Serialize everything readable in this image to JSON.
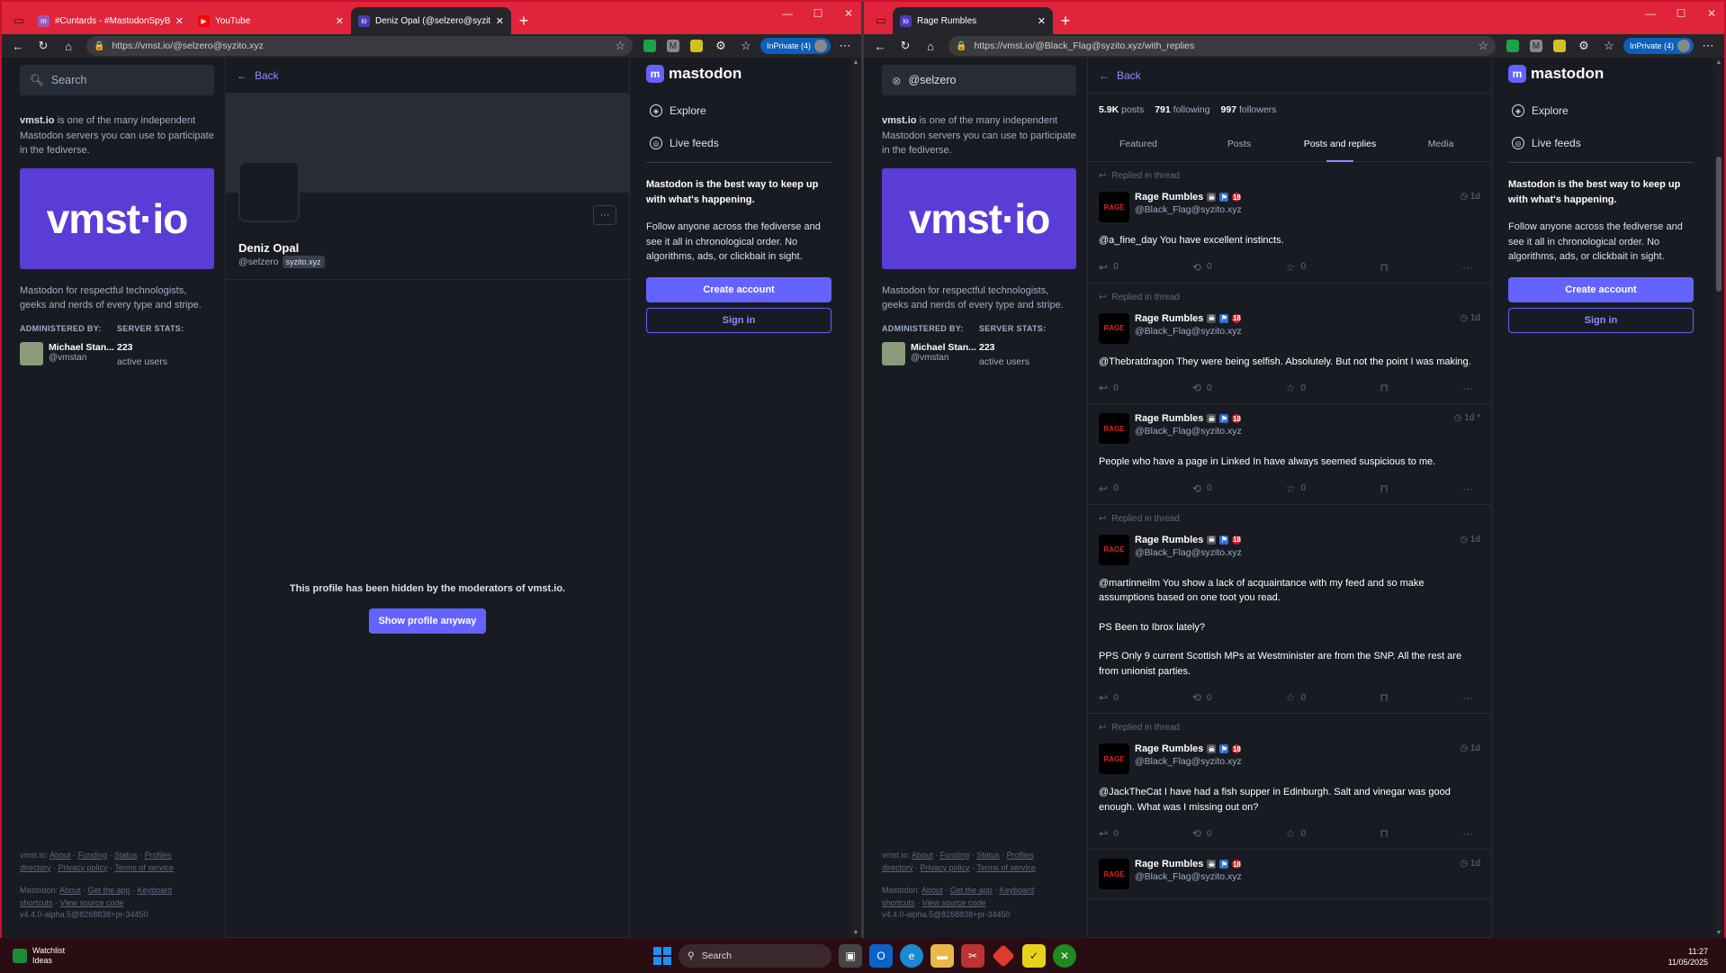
{
  "left": {
    "tabs": [
      {
        "label": "#Cuntards - #MastodonSpyBait",
        "color": "#9b59b6",
        "glyph": "m"
      },
      {
        "label": "YouTube",
        "color": "#ff0000",
        "glyph": "▶"
      },
      {
        "label": "Deniz Opal (@selzero@syzito.xyz",
        "color": "#4b3bbb",
        "glyph": "io"
      }
    ],
    "url": "https://vmst.io/@selzero@syzito.xyz",
    "search_placeholder": "Search",
    "profile": {
      "back_label": "Back",
      "name": "Deniz Opal",
      "handle": "@selzero",
      "domain": "syzito.xyz",
      "hidden_message": "This profile has been hidden by the moderators of vmst.io.",
      "show_button": "Show profile anyway"
    }
  },
  "right": {
    "tabs": [
      {
        "label": "Rage Rumbles",
        "color": "#4b3bbb",
        "glyph": "io"
      }
    ],
    "url": "https://vmst.io/@Black_Flag@syzito.xyz/with_replies",
    "search_value": "@selzero",
    "back_label": "Back",
    "stats": {
      "posts": "5.9K",
      "posts_label": "posts",
      "following": "791",
      "following_label": "following",
      "followers": "997",
      "followers_label": "followers"
    },
    "profile_tabs": [
      "Featured",
      "Posts",
      "Posts and replies",
      "Media"
    ],
    "posts": [
      {
        "replied": "Replied in thread",
        "name": "Rage Rumbles",
        "handle": "@Black_Flag@syzito.xyz",
        "time": "1d",
        "paras": [
          "@a_fine_day You have excellent instincts."
        ],
        "reply": "0",
        "boost": "0",
        "fav": "0"
      },
      {
        "replied": "Replied in thread",
        "name": "Rage Rumbles",
        "handle": "@Black_Flag@syzito.xyz",
        "time": "1d",
        "paras": [
          "@Thebratdragon They were being selfish. Absolutely. But not the point I was making."
        ],
        "reply": "0",
        "boost": "0",
        "fav": "0"
      },
      {
        "replied": "",
        "name": "Rage Rumbles",
        "handle": "@Black_Flag@syzito.xyz",
        "time": "1d *",
        "paras": [
          "People who have a page in Linked In have always seemed suspicious to me."
        ],
        "reply": "0",
        "boost": "0",
        "fav": "0"
      },
      {
        "replied": "Replied in thread",
        "name": "Rage Rumbles",
        "handle": "@Black_Flag@syzito.xyz",
        "time": "1d",
        "paras": [
          "@martinneilm You show a lack of acquaintance with my feed and so make assumptions based on one toot you read.",
          "PS Been to Ibrox lately?",
          "PPS Only 9 current Scottish MPs at Westminister are from the SNP. All the rest are from unionist parties."
        ],
        "reply": "0",
        "boost": "0",
        "fav": "0"
      },
      {
        "replied": "Replied in thread",
        "name": "Rage Rumbles",
        "handle": "@Black_Flag@syzito.xyz",
        "time": "1d",
        "paras": [
          "@JackTheCat I have had a fish supper in Edinburgh. Salt and vinegar was good enough. What was I missing out on?"
        ],
        "reply": "0",
        "boost": "0",
        "fav": "0"
      },
      {
        "replied": "",
        "name": "Rage Rumbles",
        "handle": "@Black_Flag@syzito.xyz",
        "time": "1d",
        "paras": [],
        "reply": "",
        "boost": "",
        "fav": ""
      }
    ]
  },
  "shared": {
    "about_server": "vmst.io",
    "about_text": " is one of the many independent Mastodon servers you can use to participate in the fediverse.",
    "hero_text": "vmst·io",
    "tagline": "Mastodon for respectful technologists, geeks and nerds of every type and stripe.",
    "admin_label": "ADMINISTERED BY:",
    "stats_label": "SERVER STATS:",
    "admin_name": "Michael Stan...",
    "admin_handle": "@vmstan",
    "user_count": "223",
    "user_count_label": "active users",
    "footer1_prefix": "vmst.io:",
    "footer1_links": [
      "About",
      "Funding",
      "Status",
      "Profiles directory",
      "Privacy policy",
      "Terms of service"
    ],
    "footer2_prefix": "Mastodon:",
    "footer2_links": [
      "About",
      "Get the app",
      "Keyboard shortcuts",
      "View source code"
    ],
    "version": "v4.4.0-alpha.5@8268838+pr-34450",
    "logo_text": "mastodon",
    "nav_explore": "Explore",
    "nav_live": "Live feeds",
    "pitch_title": "Mastodon is the best way to keep up with what's happening.",
    "pitch_text": "Follow anyone across the fediverse and see it all in chronological order. No algorithms, ads, or clickbait in sight.",
    "create_account": "Create account",
    "sign_in": "Sign in",
    "inprivate": "InPrivate (4)"
  },
  "taskbar": {
    "widget_title": "Watchlist",
    "widget_sub": "Ideas",
    "search": "Search",
    "time": "11:27",
    "date": "11/05/2025"
  },
  "colors": {
    "accent": "#6364ff",
    "frame": "#c8102e",
    "bg": "#191b22"
  }
}
